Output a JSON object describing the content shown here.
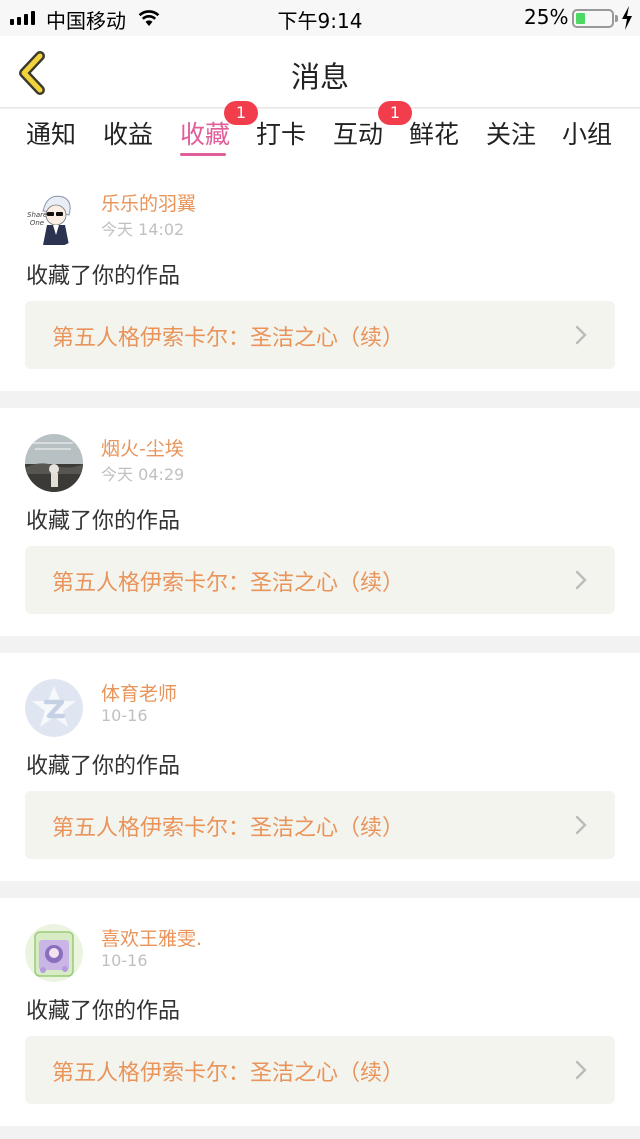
{
  "status_bar": {
    "carrier": "中国移动",
    "time": "下午9:14",
    "battery_percent": "25%",
    "battery_level": 0.25,
    "icons": [
      "signal-icon",
      "wifi-icon",
      "battery-icon",
      "charging-bolt-icon"
    ]
  },
  "nav": {
    "title": "消息",
    "back_icon": "chevron-left-icon"
  },
  "tabs": [
    {
      "label": "通知"
    },
    {
      "label": "收益"
    },
    {
      "label": "收藏",
      "badge": "1",
      "active": true
    },
    {
      "label": "打卡"
    },
    {
      "label": "互动",
      "badge": "1"
    },
    {
      "label": "鲜花"
    },
    {
      "label": "关注"
    },
    {
      "label": "小组"
    }
  ],
  "colors": {
    "accent": "#e05f99",
    "name": "#e8945a",
    "badge": "#f23d4c",
    "work_box_bg": "#f4f4ef"
  },
  "messages": [
    {
      "username": "乐乐的羽翼",
      "time": "今天 14:02",
      "action": "收藏了你的作品",
      "work_title": "第五人格伊索卡尔：圣洁之心（续）",
      "avatar_text": "Share One"
    },
    {
      "username": "烟火-尘埃",
      "time": "今天 04:29",
      "action": "收藏了你的作品",
      "work_title": "第五人格伊索卡尔：圣洁之心（续）"
    },
    {
      "username": "体育老师",
      "time": "10-16",
      "action": "收藏了你的作品",
      "work_title": "第五人格伊索卡尔：圣洁之心（续）"
    },
    {
      "username": "喜欢王雅雯.",
      "time": "10-16",
      "action": "收藏了你的作品",
      "work_title": "第五人格伊索卡尔：圣洁之心（续）"
    }
  ]
}
